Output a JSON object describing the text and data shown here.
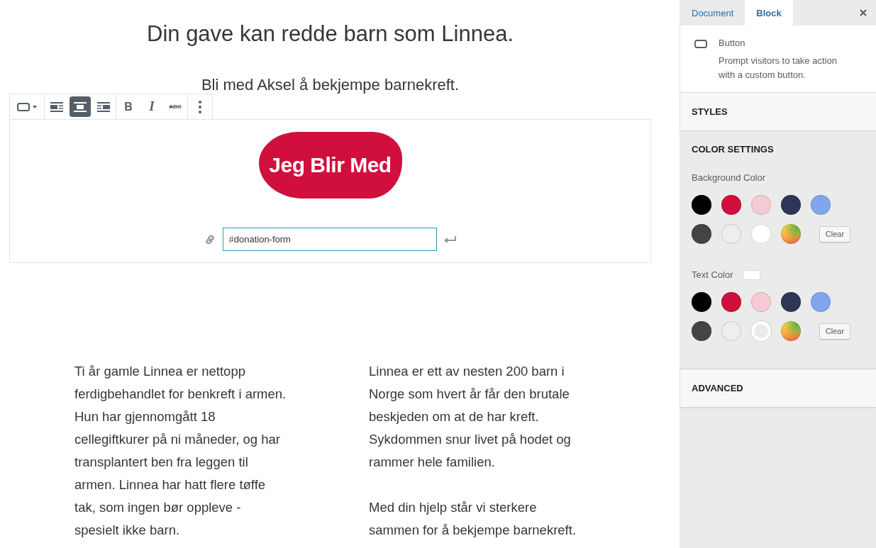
{
  "editor": {
    "heading": "Din gave kan redde barn som Linnea.",
    "subheading": "Bli med Aksel å bekjempe barnekreft.",
    "block_toolbar": {
      "groups": [
        [
          {
            "kind": "block_type"
          }
        ],
        [
          {
            "kind": "align_left",
            "selected": false
          },
          {
            "kind": "align_center",
            "selected": true
          },
          {
            "kind": "align_right",
            "selected": false
          }
        ],
        [
          {
            "kind": "bold",
            "label": "B"
          },
          {
            "kind": "italic",
            "label": "I"
          },
          {
            "kind": "strikethrough",
            "label": "ABC"
          }
        ],
        [
          {
            "kind": "more"
          }
        ]
      ]
    },
    "button_block": {
      "button_label": "Jeg Blir Med",
      "link_value": "#donation-form"
    },
    "columns": [
      {
        "paragraphs": [
          "Ti år gamle Linnea er nettopp ferdigbehandlet for benkreft i armen. Hun har gjennomgått 18 cellegiftkurer på ni måneder, og har transplantert ben fra leggen til armen. Linnea har hatt flere tøffe tak, som ingen bør oppleve - spesielt ikke barn."
        ]
      },
      {
        "paragraphs": [
          "Linnea er ett av nesten 200 barn i Norge som hvert år får den brutale beskjeden om at de har kreft. Sykdommen snur livet på hodet og rammer hele familien.",
          "Med din hjelp står vi sterkere sammen for å bekjempe barnekreft."
        ]
      }
    ]
  },
  "sidebar": {
    "tabs": [
      {
        "label": "Document",
        "selected": false
      },
      {
        "label": "Block",
        "selected": true
      }
    ],
    "block_card": {
      "title": "Button",
      "description": "Prompt visitors to take action with a custom button."
    },
    "panels": [
      {
        "title": "STYLES",
        "expanded": false
      },
      {
        "title": "COLOR SETTINGS",
        "expanded": true,
        "sections": [
          {
            "label": "Background Color",
            "clear_label": "Clear",
            "swatches": [
              {
                "kind": "preset",
                "color": "#000000",
                "selected": false
              },
              {
                "kind": "preset",
                "color": "#d10f3d",
                "selected": false
              },
              {
                "kind": "preset",
                "color": "#f6cbd6",
                "selected": false
              },
              {
                "kind": "preset",
                "color": "#2d3656",
                "selected": false
              },
              {
                "kind": "preset",
                "color": "#82a5ef",
                "selected": false
              },
              {
                "kind": "preset",
                "color": "#444444",
                "selected": false
              },
              {
                "kind": "preset",
                "color": "#eeeeee",
                "selected": false
              },
              {
                "kind": "preset",
                "color": "#ffffff",
                "selected": false
              },
              {
                "kind": "custom",
                "selected": false
              }
            ]
          },
          {
            "label": "Text Color",
            "clear_label": "Clear",
            "swatches": [
              {
                "kind": "preset",
                "color": "#000000",
                "selected": false
              },
              {
                "kind": "preset",
                "color": "#d10f3d",
                "selected": false
              },
              {
                "kind": "preset",
                "color": "#f6cbd6",
                "selected": false
              },
              {
                "kind": "preset",
                "color": "#2d3656",
                "selected": false
              },
              {
                "kind": "preset",
                "color": "#82a5ef",
                "selected": false
              },
              {
                "kind": "preset",
                "color": "#444444",
                "selected": false
              },
              {
                "kind": "preset",
                "color": "#eeeeee",
                "selected": false
              },
              {
                "kind": "preset",
                "color": "#ffffff",
                "selected": true
              },
              {
                "kind": "custom",
                "selected": false
              }
            ]
          }
        ]
      },
      {
        "title": "ADVANCED",
        "expanded": false
      }
    ]
  }
}
